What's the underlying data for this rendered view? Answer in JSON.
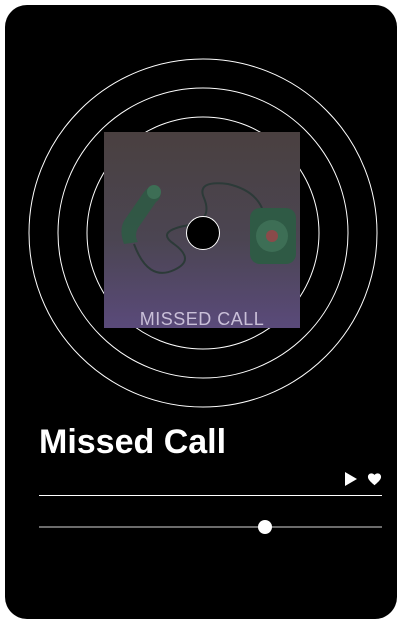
{
  "track": {
    "title": "Missed Call",
    "artwork_caption": "MISSED CALL",
    "progress": 0.66
  },
  "controls": {
    "play_icon": "play-icon",
    "like_icon": "heart-icon"
  },
  "colors": {
    "background": "#000000",
    "foreground": "#ffffff",
    "track": "#6b6b6b",
    "art_top": "#4a4040",
    "art_bottom": "#5a4a7a"
  }
}
